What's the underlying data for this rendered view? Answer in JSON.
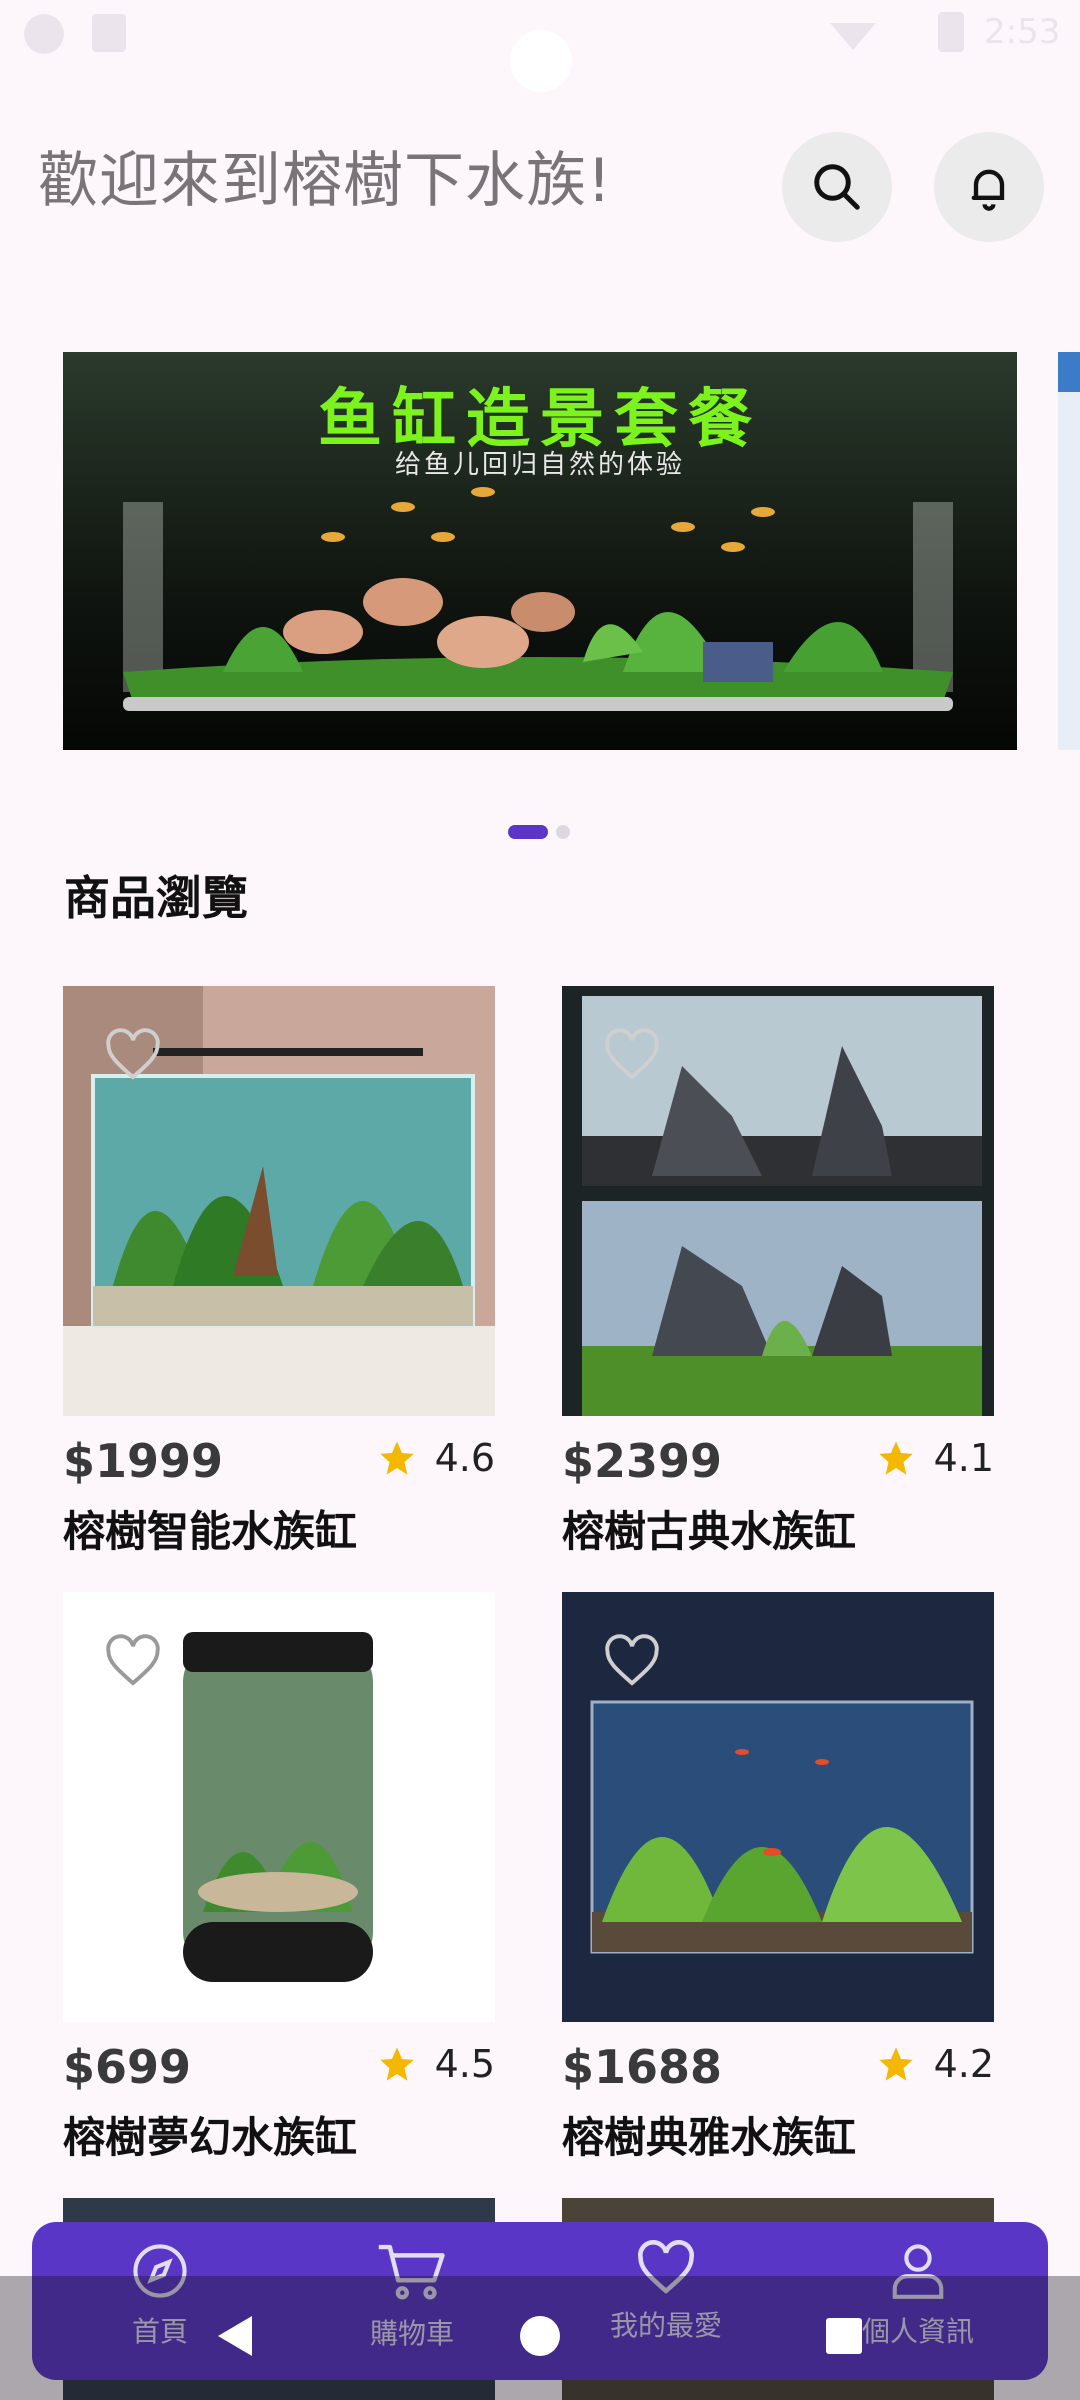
{
  "status_bar": {
    "time": "2:53"
  },
  "header": {
    "welcome": "歡迎來到榕樹下水族!"
  },
  "banner": {
    "title": "鱼缸造景套餐",
    "subtitle": "给鱼儿回归自然的体验"
  },
  "section": {
    "title": "商品瀏覽"
  },
  "products": [
    {
      "price": "$1999",
      "rating": "4.6",
      "name": "榕樹智能水族缸"
    },
    {
      "price": "$2399",
      "rating": "4.1",
      "name": "榕樹古典水族缸"
    },
    {
      "price": "$699",
      "rating": "4.5",
      "name": "榕樹夢幻水族缸"
    },
    {
      "price": "$1688",
      "rating": "4.2",
      "name": "榕樹典雅水族缸"
    }
  ],
  "nav": {
    "home": "首頁",
    "cart": "購物車",
    "favorites": "我的最愛",
    "profile": "個人資訊"
  },
  "colors": {
    "accent": "#5a36c6",
    "star": "#f5b800",
    "background": "#fdf7fc"
  },
  "icons": [
    "search-icon",
    "bell-icon",
    "heart-icon",
    "star-icon",
    "compass-icon",
    "cart-icon",
    "person-icon"
  ]
}
